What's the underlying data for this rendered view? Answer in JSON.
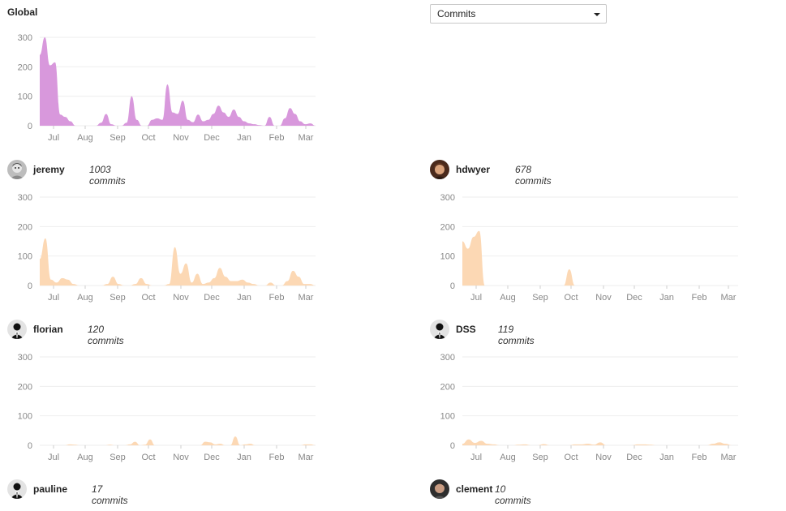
{
  "global": {
    "title": "Global"
  },
  "metric_select": {
    "value": "Commits"
  },
  "users": [
    {
      "name": "jeremy",
      "commits": "1003 commits",
      "avatar": "photo-avatar"
    },
    {
      "name": "hdwyer",
      "commits": "678 commits",
      "avatar": "photo-avatar"
    },
    {
      "name": "florian",
      "commits": "120 commits",
      "avatar": "default-avatar"
    },
    {
      "name": "DSS",
      "commits": "119 commits",
      "avatar": "default-avatar"
    },
    {
      "name": "pauline",
      "commits": "17 commits",
      "avatar": "default-avatar"
    },
    {
      "name": "clement",
      "commits": "10 commits",
      "avatar": "photo-avatar"
    }
  ],
  "colors": {
    "global_fill": "#d898dc",
    "user_fill": "#fcd8b4",
    "grid": "#eeeeee"
  },
  "chart_data": [
    {
      "type": "area",
      "title": "Global",
      "ylim": [
        0,
        300
      ],
      "yticks": [
        "0",
        "100",
        "200",
        "300"
      ],
      "xticks": [
        "Jul",
        "Aug",
        "Sep",
        "Oct",
        "Nov",
        "Dec",
        "Jan",
        "Feb",
        "Mar"
      ],
      "x": [
        "2018-06-19",
        "2018-06-24",
        "2018-06-29",
        "2018-07-04",
        "2018-07-09",
        "2018-07-14",
        "2018-07-19",
        "2018-07-24",
        "2018-07-29",
        "2018-08-03",
        "2018-08-08",
        "2018-08-13",
        "2018-08-18",
        "2018-08-23",
        "2018-08-28",
        "2018-09-02",
        "2018-09-07",
        "2018-09-12",
        "2018-09-17",
        "2018-09-22",
        "2018-09-27",
        "2018-10-02",
        "2018-10-07",
        "2018-10-12",
        "2018-10-17",
        "2018-10-22",
        "2018-10-27",
        "2018-11-01",
        "2018-11-06",
        "2018-11-11",
        "2018-11-16",
        "2018-11-21",
        "2018-11-26",
        "2018-12-01",
        "2018-12-06",
        "2018-12-11",
        "2018-12-16",
        "2018-12-21",
        "2018-12-26",
        "2018-12-31",
        "2019-01-05",
        "2019-01-10",
        "2019-01-15",
        "2019-01-20",
        "2019-01-25",
        "2019-01-30",
        "2019-02-04",
        "2019-02-09",
        "2019-02-14",
        "2019-02-19",
        "2019-02-24",
        "2019-03-01",
        "2019-03-06",
        "2019-03-11",
        "2019-03-16"
      ],
      "values": [
        240,
        300,
        205,
        215,
        38,
        30,
        15,
        0,
        0,
        0,
        0,
        0,
        10,
        40,
        5,
        0,
        0,
        10,
        100,
        20,
        0,
        0,
        20,
        25,
        20,
        140,
        45,
        40,
        85,
        20,
        12,
        38,
        15,
        20,
        40,
        68,
        45,
        30,
        55,
        30,
        15,
        8,
        5,
        2,
        0,
        30,
        0,
        0,
        25,
        60,
        40,
        15,
        5,
        8,
        0
      ]
    },
    {
      "type": "area",
      "title": "jeremy",
      "ylim": [
        0,
        300
      ],
      "yticks": [
        "0",
        "100",
        "200",
        "300"
      ],
      "xticks": [
        "Jul",
        "Aug",
        "Sep",
        "Oct",
        "Nov",
        "Dec",
        "Jan",
        "Feb",
        "Mar"
      ],
      "values": [
        90,
        160,
        20,
        10,
        25,
        20,
        5,
        0,
        0,
        0,
        0,
        0,
        5,
        30,
        5,
        0,
        0,
        5,
        25,
        5,
        0,
        0,
        0,
        5,
        130,
        40,
        75,
        10,
        40,
        5,
        10,
        25,
        60,
        30,
        15,
        15,
        20,
        10,
        5,
        0,
        0,
        10,
        0,
        0,
        15,
        50,
        30,
        5,
        5,
        0
      ]
    },
    {
      "type": "area",
      "title": "hdwyer",
      "ylim": [
        0,
        300
      ],
      "yticks": [
        "0",
        "100",
        "200",
        "300"
      ],
      "xticks": [
        "Jul",
        "Aug",
        "Sep",
        "Oct",
        "Nov",
        "Dec",
        "Jan",
        "Feb",
        "Mar"
      ],
      "values": [
        150,
        125,
        165,
        185,
        0,
        0,
        0,
        0,
        0,
        0,
        0,
        0,
        0,
        0,
        0,
        0,
        0,
        0,
        0,
        55,
        0,
        0,
        0,
        0,
        0,
        0,
        0,
        0,
        0,
        0,
        0,
        0,
        0,
        0,
        0,
        0,
        0,
        0,
        0,
        0,
        0,
        0,
        0,
        0,
        0,
        0,
        0,
        0,
        0,
        0
      ]
    },
    {
      "type": "area",
      "title": "florian",
      "ylim": [
        0,
        300
      ],
      "yticks": [
        "0",
        "100",
        "200",
        "300"
      ],
      "xticks": [
        "Jul",
        "Aug",
        "Sep",
        "Oct",
        "Nov",
        "Dec",
        "Jan",
        "Feb",
        "Mar"
      ],
      "values": [
        0,
        0,
        0,
        0,
        0,
        0,
        3,
        2,
        0,
        0,
        0,
        0,
        0,
        0,
        2,
        0,
        0,
        0,
        3,
        12,
        0,
        2,
        20,
        0,
        0,
        0,
        0,
        0,
        0,
        0,
        0,
        0,
        0,
        12,
        10,
        3,
        5,
        0,
        0,
        30,
        0,
        3,
        5,
        0,
        0,
        0,
        0,
        0,
        0,
        0,
        0,
        0,
        0,
        3,
        3,
        0
      ]
    },
    {
      "type": "area",
      "title": "DSS",
      "ylim": [
        0,
        300
      ],
      "yticks": [
        "0",
        "100",
        "200",
        "300"
      ],
      "xticks": [
        "Jul",
        "Aug",
        "Sep",
        "Oct",
        "Nov",
        "Dec",
        "Jan",
        "Feb",
        "Mar"
      ],
      "values": [
        5,
        20,
        8,
        15,
        5,
        3,
        0,
        0,
        0,
        2,
        3,
        0,
        0,
        4,
        0,
        0,
        0,
        0,
        3,
        3,
        5,
        2,
        10,
        0,
        0,
        0,
        0,
        0,
        3,
        3,
        2,
        0,
        0,
        0,
        0,
        0,
        0,
        0,
        0,
        0,
        5,
        10,
        5,
        0,
        0
      ]
    }
  ]
}
